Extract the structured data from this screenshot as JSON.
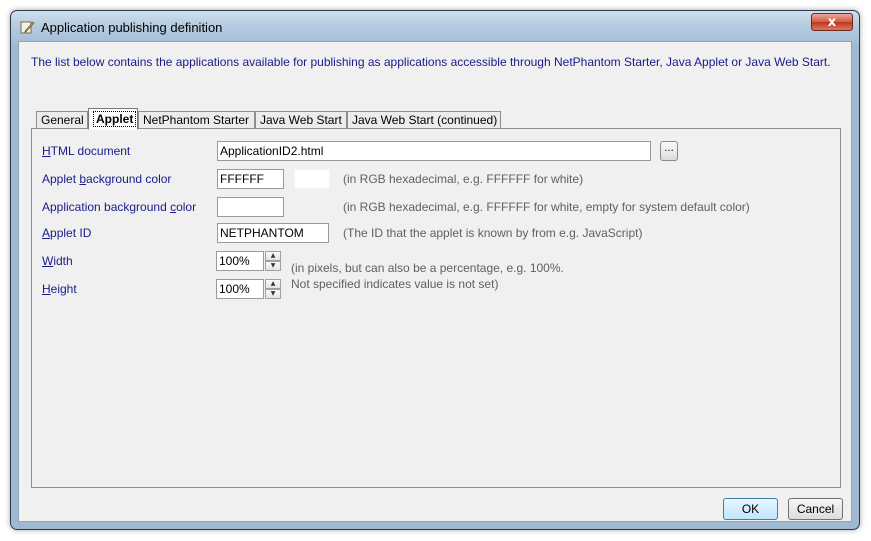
{
  "window": {
    "title": "Application publishing definition",
    "close_label": "x"
  },
  "description": "The list below contains the applications available for publishing as applications accessible through NetPhantom Starter, Java Applet or Java Web Start.",
  "tabs": [
    {
      "label": "General",
      "active": false
    },
    {
      "label": "Applet",
      "active": true
    },
    {
      "label": "NetPhantom Starter",
      "active": false
    },
    {
      "label": "Java Web Start",
      "active": false
    },
    {
      "label": "Java Web Start (continued)",
      "active": false
    }
  ],
  "form": {
    "html_document": {
      "label": "HTML document",
      "value": "ApplicationID2.html",
      "browse_label": "..."
    },
    "applet_bg": {
      "label": "Applet background color",
      "value": "FFFFFF",
      "swatch_color": "#FFFFFF",
      "hint": "(in RGB hexadecimal, e.g. FFFFFF for white)"
    },
    "app_bg": {
      "label": "Application background color",
      "value": "",
      "hint": "(in RGB hexadecimal, e.g. FFFFFF for white, empty for system default color)"
    },
    "applet_id": {
      "label": "Applet ID",
      "value": "NETPHANTOM",
      "hint": "(The ID that the applet is known by from e.g. JavaScript)"
    },
    "width": {
      "label": "Width",
      "value": "100%"
    },
    "height": {
      "label": "Height",
      "value": "100%"
    },
    "size_hint_1": "(in pixels, but can also be a percentage, e.g. 100%.",
    "size_hint_2": "Not specified indicates value is not set)"
  },
  "buttons": {
    "ok": "OK",
    "cancel": "Cancel"
  },
  "colors": {
    "label_text": "#1a1a8c",
    "hint_text": "#606060",
    "dialog_bg": "#f0f0f0"
  }
}
